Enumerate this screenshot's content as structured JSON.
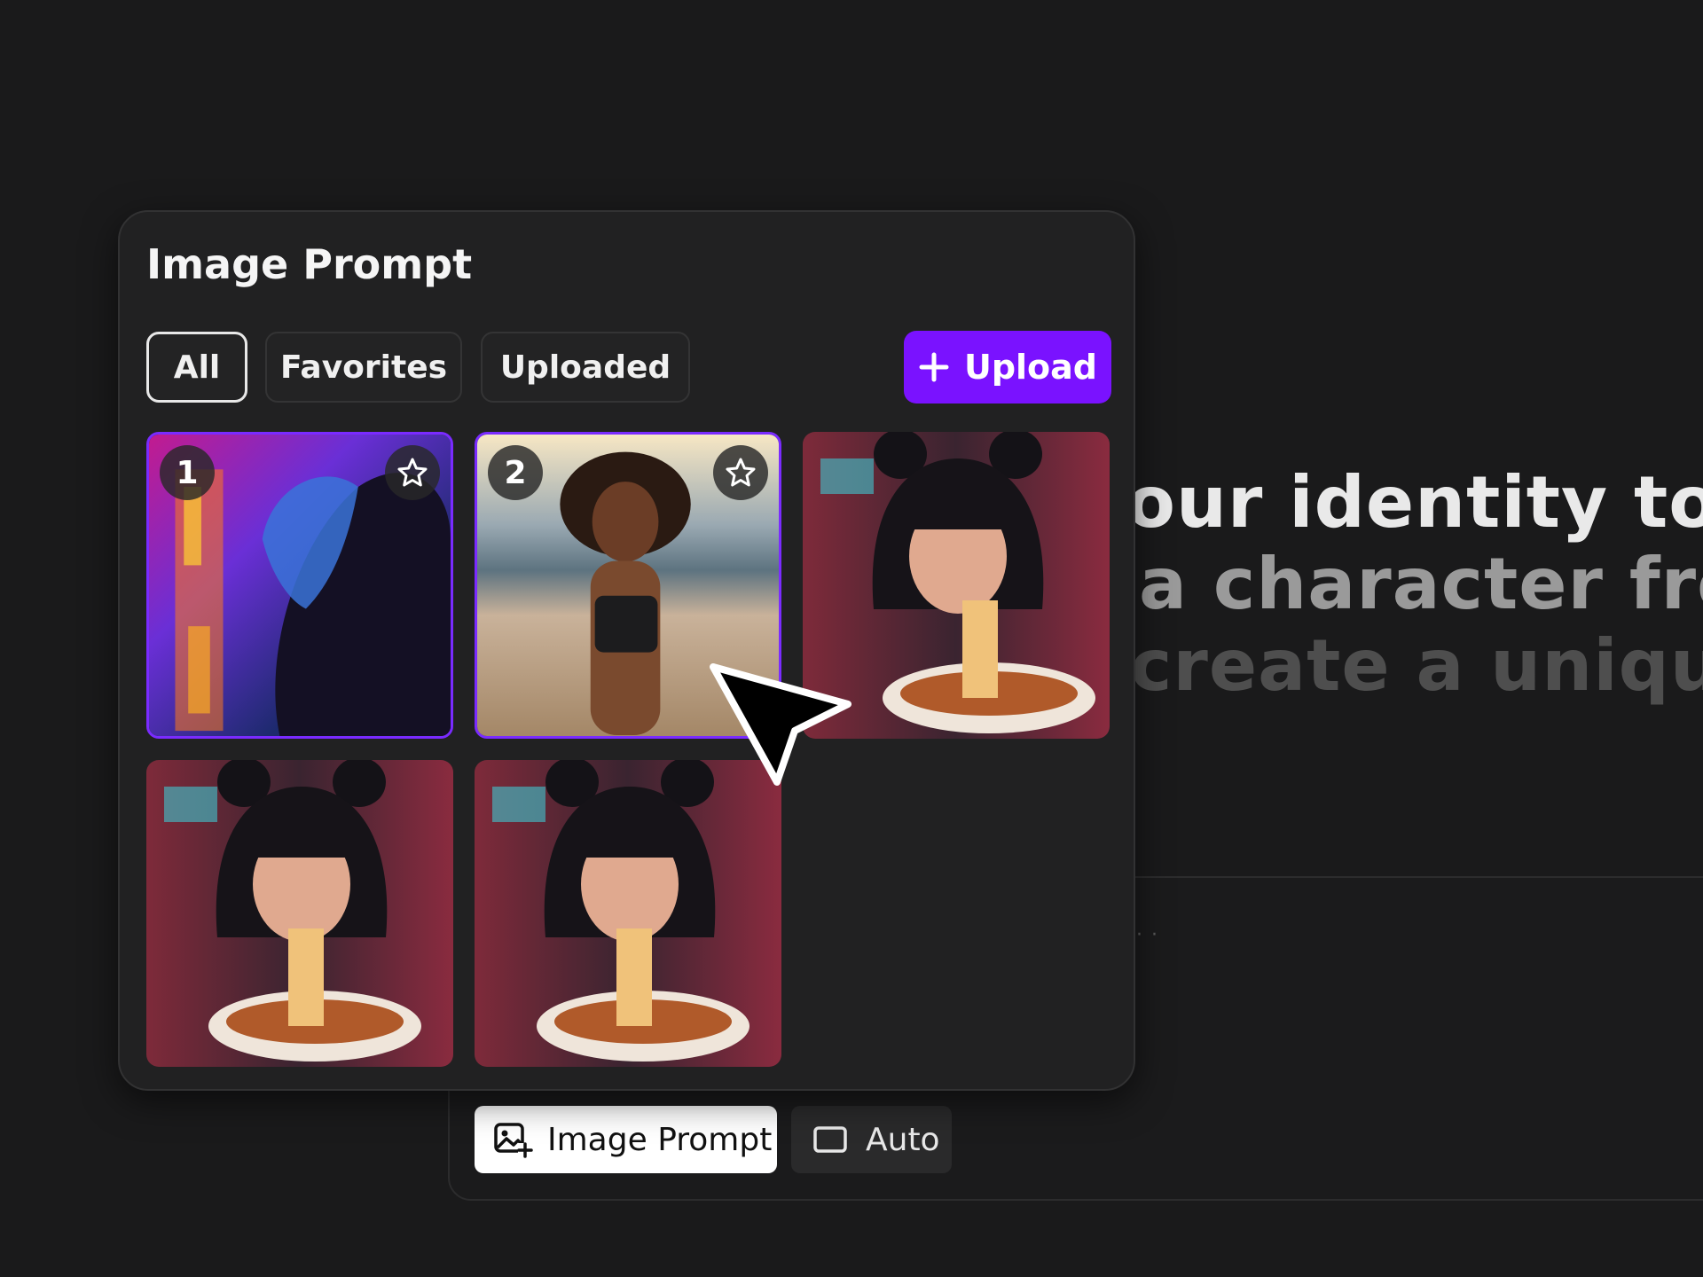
{
  "background": {
    "hero_lines": [
      "our identity to cr",
      "a character from",
      "create a unique p"
    ]
  },
  "composer": {
    "chips": [
      {
        "label": "Image Prompt",
        "icon": "image-add-icon",
        "active": true
      },
      {
        "label": "Auto",
        "icon": "aspect-ratio-icon",
        "active": false
      }
    ]
  },
  "panel": {
    "title": "Image Prompt",
    "filters": [
      {
        "label": "All",
        "active": true
      },
      {
        "label": "Favorites",
        "active": false
      },
      {
        "label": "Uploaded",
        "active": false
      }
    ],
    "upload_label": "Upload",
    "images": [
      {
        "badge": "1",
        "selected": true,
        "favorite_icon": "star-icon"
      },
      {
        "badge": "2",
        "selected": true,
        "favorite_icon": "star-icon"
      },
      {
        "selected": false
      },
      {
        "selected": false
      },
      {
        "selected": false
      }
    ]
  },
  "colors": {
    "accent": "#7a12ff",
    "selection_border": "#7a2bff",
    "background": "#1a1a1b",
    "panel": "#212122"
  }
}
